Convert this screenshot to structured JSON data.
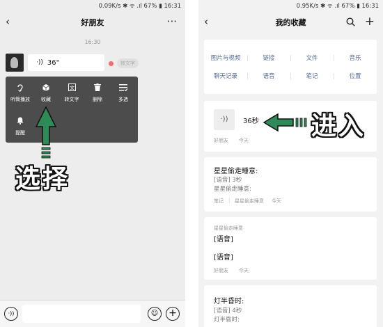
{
  "left": {
    "status_bar": "0.09K/s ✱ ᯤ .ıl 67% ▮ 16:31",
    "title": "好朋友",
    "timestamp": "16:30",
    "voice_message": {
      "duration": "36\""
    },
    "to_text_chip": "转文字",
    "context_menu": [
      "听筒播放",
      "收藏",
      "转文字",
      "删除",
      "多选",
      "提醒"
    ],
    "annotation": "选择"
  },
  "right": {
    "status_bar": "0.95K/s ✱ ᯤ .ıl 67% ▮ 16:31",
    "title": "我的收藏",
    "categories": [
      "图片与视频",
      "链接",
      "文件",
      "音乐",
      "聊天记录",
      "语音",
      "笔记",
      "位置"
    ],
    "voice_item": {
      "duration": "36秒",
      "source": "好朋友",
      "time": "今天"
    },
    "note_item": {
      "title": "星星偷走睡意:",
      "line1": "[语音] 3秒",
      "line2": "星星偷走睡意:",
      "tag": "笔记",
      "source": "星星偷走睡意",
      "time": "今天"
    },
    "chat_item": {
      "small_title": "星星偷走睡意",
      "line1": "[语音]",
      "line2": "[语音]",
      "source": "好朋友",
      "time": "今天"
    },
    "partial_item": {
      "title": "灯半昏时:",
      "line1": "[语音] 4秒",
      "line2": "灯半昏时:"
    },
    "annotation": "进入"
  },
  "colors": {
    "arrow_green": "#2e8b57",
    "link_blue": "#576b95",
    "dot_red": "#f56a6a"
  }
}
